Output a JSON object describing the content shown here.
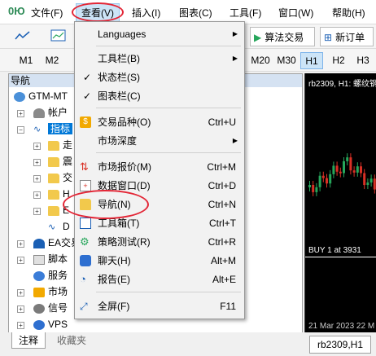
{
  "menubar": {
    "app_label": "0Ю",
    "items": [
      "文件(F)",
      "查看(V)",
      "插入(I)",
      "图表(C)",
      "工具(F)",
      "窗口(W)",
      "帮助(H)"
    ]
  },
  "toolbar": {
    "algo_trading": "算法交易",
    "new_order": "新订单"
  },
  "timeframes": [
    "M1",
    "M2",
    "M20",
    "M30",
    "H1",
    "H2",
    "H3"
  ],
  "navigator": {
    "title": "导航",
    "account_root": "GTM-MT",
    "accounts": "帐户",
    "indicators": "指标",
    "sub_folders": [
      "走",
      "震",
      "交",
      "H",
      "E"
    ],
    "sub_item_d": "D",
    "expert_advisors": "EA交易",
    "scripts": "脚本",
    "services": "服务",
    "market": "市场",
    "signals": "信号",
    "vps": "VPS"
  },
  "bottom_tabs": [
    "注释",
    "收藏夹"
  ],
  "chart": {
    "title": "rb2309, H1: 螺纹钢",
    "buy_label": "BUY 1 at 3931",
    "date_label": "21 Mar 2023   22 M",
    "tab": "rb2309,H1"
  },
  "view_menu": {
    "languages": "Languages",
    "toolbars": "工具栏(B)",
    "status_bar": "状态栏(S)",
    "chart_bar": "图表栏(C)",
    "symbols": "交易品种(O)",
    "symbols_sc": "Ctrl+U",
    "depth": "市场深度",
    "market_watch": "市场报价(M)",
    "market_watch_sc": "Ctrl+M",
    "data_window": "数据窗口(D)",
    "data_window_sc": "Ctrl+D",
    "navigator": "导航(N)",
    "navigator_sc": "Ctrl+N",
    "toolbox": "工具箱(T)",
    "toolbox_sc": "Ctrl+T",
    "strategy_tester": "策略测试(R)",
    "strategy_tester_sc": "Ctrl+R",
    "chat": "聊天(H)",
    "chat_sc": "Alt+M",
    "reports": "报告(E)",
    "reports_sc": "Alt+E",
    "fullscreen": "全屏(F)",
    "fullscreen_sc": "F11"
  },
  "colors": {
    "highlight_ellipse": "#e32636",
    "selection": "#0078d7",
    "chart_bg": "#000000",
    "candle_up": "#26a65b",
    "candle_down": "#d93025"
  }
}
